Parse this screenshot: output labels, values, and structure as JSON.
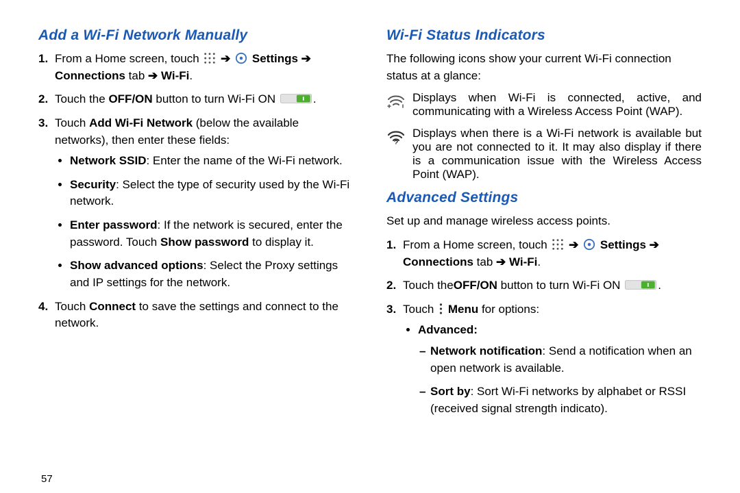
{
  "page_number": "57",
  "left": {
    "heading": "Add a Wi-Fi Network Manually",
    "step1_pre": "From a Home screen, touch ",
    "step1_mid": " Settings ",
    "step1_conn": "Connections",
    "step1_tab": " tab ",
    "step1_wifi": " Wi-Fi",
    "step2_pre": "Touch the ",
    "step2_offon": "OFF/ON",
    "step2_post": " button to turn Wi-Fi ON ",
    "step3_pre": "Touch ",
    "step3_b": "Add Wi-Fi Network",
    "step3_post": " (below the available networks), then enter these fields:",
    "b1_b": "Network SSID",
    "b1_post": ": Enter the name of the Wi-Fi network.",
    "b2_b": "Security",
    "b2_post": ": Select the type of security used by the Wi-Fi network.",
    "b3_b": "Enter password",
    "b3_mid": ": If the network is secured, enter the password. Touch ",
    "b3_b2": "Show password",
    "b3_post": " to display it.",
    "b4_b": "Show advanced options",
    "b4_post": ": Select the Proxy settings and IP settings for the network.",
    "step4_pre": "Touch ",
    "step4_b": "Connect",
    "step4_post": " to save the settings and connect to the network."
  },
  "right": {
    "heading1": "Wi-Fi Status Indicators",
    "intro1": "The following icons show your current Wi-Fi connection status at a glance:",
    "ind1": "Displays when Wi-Fi is connected, active, and communicating with a Wireless Access Point (WAP).",
    "ind2": "Displays when there is a Wi-Fi network is available but you are not connected to it. It may also display if there is a communication issue with the Wireless Access Point (WAP).",
    "heading2": "Advanced Settings",
    "intro2": "Set up and manage wireless access points.",
    "a_step1_pre": "From a Home screen, touch ",
    "a_step1_mid": " Settings ",
    "a_step1_conn": "Connections",
    "a_step1_tab": " tab ",
    "a_step1_wifi": " Wi-Fi",
    "a_step2_pre": "Touch the",
    "a_step2_offon": "OFF/ON",
    "a_step2_post": "  button to turn Wi-Fi ON ",
    "a_step3_pre": "Touch ",
    "a_step3_menu": " Menu",
    "a_step3_post": " for options:",
    "adv_label": "Advanced:",
    "d1_b": "Network notification",
    "d1_post": ": Send a notification when an open network is available.",
    "d2_b": "Sort by",
    "d2_post": ": Sort Wi-Fi networks by alphabet or RSSI (received signal strength indicato)."
  },
  "arrow": "➔",
  "period": "."
}
